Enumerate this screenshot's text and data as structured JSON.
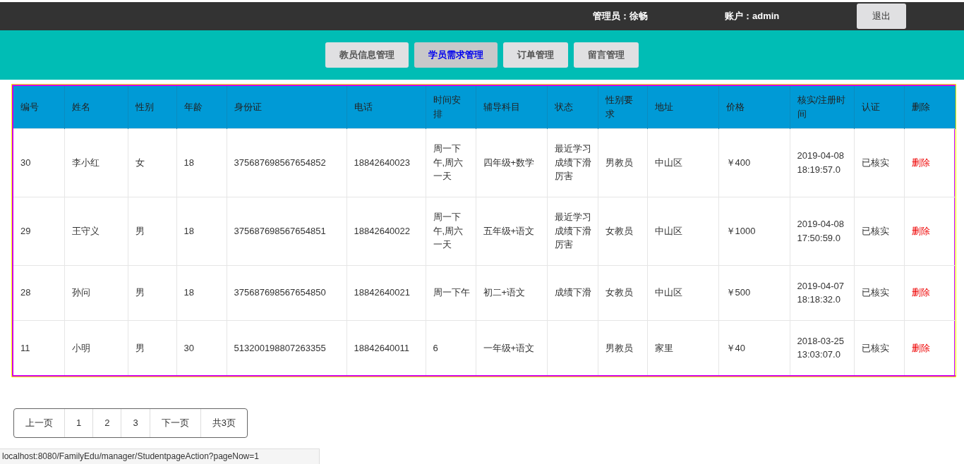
{
  "header": {
    "admin_label": "管理员：徐畅",
    "account_label": "账户：admin",
    "logout_button": "退出"
  },
  "nav_tabs": [
    {
      "label": "教员信息管理",
      "selected": false
    },
    {
      "label": "学员需求管理",
      "selected": true
    },
    {
      "label": "订单管理",
      "selected": false
    },
    {
      "label": "留言管理",
      "selected": false
    }
  ],
  "table": {
    "columns": [
      "编号",
      "姓名",
      "性别",
      "年龄",
      "身份证",
      "电话",
      "时间安排",
      "辅导科目",
      "状态",
      "性别要求",
      "地址",
      "价格",
      "核实/注册时间",
      "认证",
      "删除"
    ],
    "rows": [
      {
        "cells": [
          "30",
          "李小红",
          "女",
          "18",
          "375687698567654852",
          "18842640023",
          "周一下午,周六一天",
          "四年级+数学",
          "最近学习成绩下滑厉害",
          "男教员",
          "中山区",
          "￥400",
          "2019-04-08 18:19:57.0",
          "已核实"
        ],
        "delete": "删除"
      },
      {
        "cells": [
          "29",
          "王守义",
          "男",
          "18",
          "375687698567654851",
          "18842640022",
          "周一下午,周六一天",
          "五年级+语文",
          "最近学习成绩下滑厉害",
          "女教员",
          "中山区",
          "￥1000",
          "2019-04-08 17:50:59.0",
          "已核实"
        ],
        "delete": "删除"
      },
      {
        "cells": [
          "28",
          "孙问",
          "男",
          "18",
          "375687698567654850",
          "18842640021",
          "周一下午",
          "初二+语文",
          "成绩下滑",
          "女教员",
          "中山区",
          "￥500",
          "2019-04-07 18:18:32.0",
          "已核实"
        ],
        "delete": "删除"
      },
      {
        "cells": [
          "11",
          "小明",
          "男",
          "30",
          "513200198807263355",
          "18842640011",
          "6",
          "一年级+语文",
          "",
          "男教员",
          "家里",
          "￥40",
          "2018-03-25 13:03:07.0",
          "已核实"
        ],
        "delete": "删除"
      }
    ]
  },
  "pagination": [
    "上一页",
    "1",
    "2",
    "3",
    "下一页",
    "共3页"
  ],
  "status_bar": "localhost:8080/FamilyEdu/manager/StudentpageAction?pageNow=1"
}
